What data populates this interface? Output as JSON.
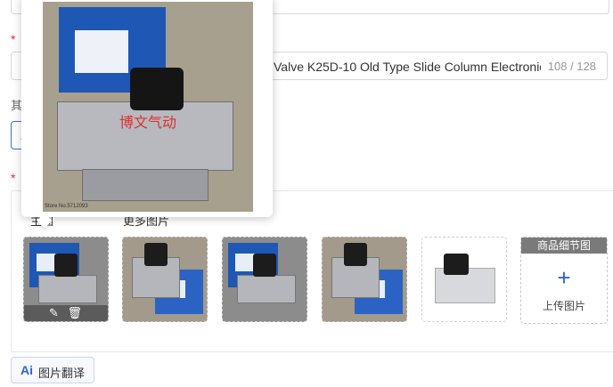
{
  "form": {
    "title_required_mark": "*",
    "title_value": "Valve K25D-10 Old Type Slide Column Electronic",
    "title_count": "108 / 128",
    "other_label_frag": "其",
    "ai_button_glyph": "A",
    "images_required_mark": "*"
  },
  "image_section": {
    "tab_main_frag": "主图",
    "tab_more": "更多图片",
    "thumb_tools": [
      "edit-icon",
      "delete-icon"
    ],
    "upload_tag": "商品细节图",
    "upload_plus": "+",
    "upload_label": "上传图片"
  },
  "translate": {
    "ai_glyph": "Ai",
    "label": "图片翻译"
  },
  "preview": {
    "stamp_text": "博文气动",
    "store_text": "Store No.5712093"
  },
  "colors": {
    "accent": "#2f63d8",
    "required": "#f5222d"
  }
}
